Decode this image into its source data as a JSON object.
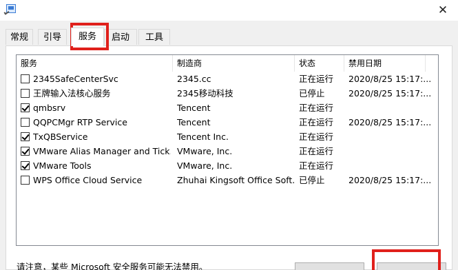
{
  "window": {
    "close_glyph": "✕"
  },
  "tabs": [
    {
      "label": "常规",
      "active": false
    },
    {
      "label": "引导",
      "active": false
    },
    {
      "label": "服务",
      "active": true
    },
    {
      "label": "启动",
      "active": false
    },
    {
      "label": "工具",
      "active": false
    }
  ],
  "table": {
    "headers": [
      "服务",
      "制造商",
      "状态",
      "禁用日期"
    ],
    "rows": [
      {
        "checked": false,
        "service": "2345SafeCenterSvc",
        "maker": "2345.cc",
        "status": "正在运行",
        "date": "2020/8/25 15:17:..."
      },
      {
        "checked": false,
        "service": "王牌输入法核心服务",
        "maker": "2345移动科技",
        "status": "已停止",
        "date": "2020/8/25 15:17:..."
      },
      {
        "checked": true,
        "service": "qmbsrv",
        "maker": "Tencent",
        "status": "正在运行",
        "date": ""
      },
      {
        "checked": false,
        "service": "QQPCMgr RTP Service",
        "maker": "Tencent",
        "status": "正在运行",
        "date": "2020/8/25 15:17:..."
      },
      {
        "checked": true,
        "service": "TxQBService",
        "maker": "Tencent Inc.",
        "status": "正在运行",
        "date": ""
      },
      {
        "checked": true,
        "service": "VMware Alias Manager and Tick...",
        "maker": "VMware, Inc.",
        "status": "正在运行",
        "date": ""
      },
      {
        "checked": true,
        "service": "VMware Tools",
        "maker": "VMware, Inc.",
        "status": "正在运行",
        "date": ""
      },
      {
        "checked": false,
        "service": "WPS Office Cloud Service",
        "maker": "Zhuhai Kingsoft Office Soft...",
        "status": "已停止",
        "date": "2020/8/25 15:17:..."
      }
    ]
  },
  "footer": {
    "notice": "请注意，某些 Microsoft 安全服务可能无法禁用。"
  },
  "colors": {
    "highlight": "#e0201b"
  }
}
